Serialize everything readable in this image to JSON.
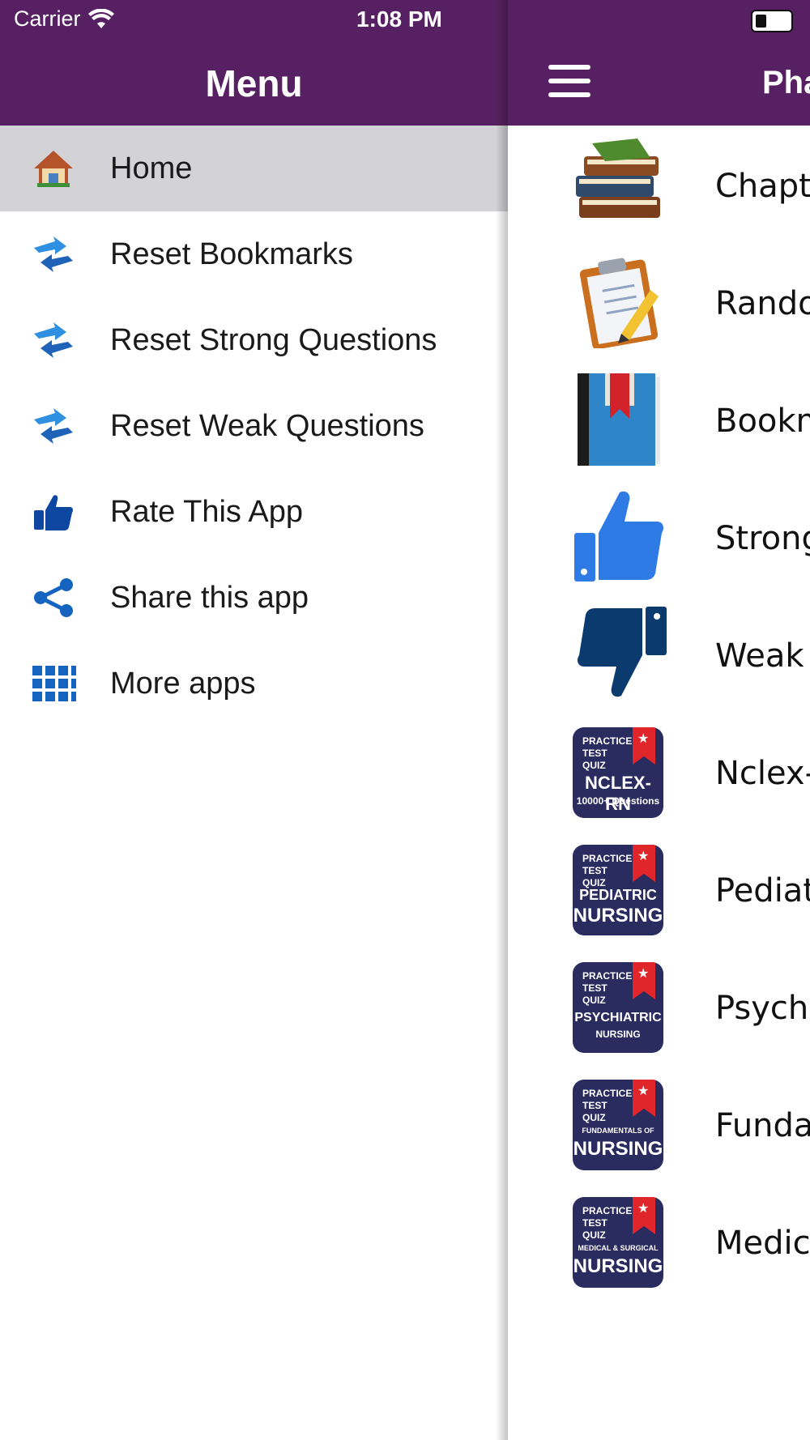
{
  "status_bar": {
    "carrier": "Carrier",
    "time": "1:08 PM"
  },
  "drawer": {
    "title": "Menu",
    "items": [
      {
        "label": "Home",
        "icon": "home-icon",
        "active": true
      },
      {
        "label": "Reset Bookmarks",
        "icon": "reset-icon"
      },
      {
        "label": "Reset Strong Questions",
        "icon": "reset-icon"
      },
      {
        "label": "Reset Weak Questions",
        "icon": "reset-icon"
      },
      {
        "label": "Rate This App",
        "icon": "thumbs-up-icon"
      },
      {
        "label": "Share this app",
        "icon": "share-icon"
      },
      {
        "label": "More apps",
        "icon": "grid-icon"
      }
    ]
  },
  "main": {
    "title": "Pha",
    "items": [
      {
        "label": "Chapte",
        "icon": "books-icon"
      },
      {
        "label": "Rando",
        "icon": "clipboard-icon"
      },
      {
        "label": "Bookm",
        "icon": "bookmark-book-icon"
      },
      {
        "label": "Strong",
        "icon": "thumbs-up-icon"
      },
      {
        "label": "Weak",
        "icon": "thumbs-down-icon"
      },
      {
        "label": "Nclex-",
        "icon": "nclex-app-icon",
        "badge_top": "PRACTICE TEST QUIZ",
        "badge_main": "NCLEX-RN",
        "badge_sub": "10000+ Questions"
      },
      {
        "label": "Pediat",
        "icon": "pediatric-app-icon",
        "badge_top": "PRACTICE TEST QUIZ",
        "badge_main": "PEDIATRIC",
        "badge_sub": "NURSING"
      },
      {
        "label": "Psychi",
        "icon": "psychiatric-app-icon",
        "badge_top": "PRACTICE TEST QUIZ",
        "badge_main": "PSYCHIATRIC",
        "badge_sub": "NURSING"
      },
      {
        "label": "Funda",
        "icon": "fundamentals-app-icon",
        "badge_top": "PRACTICE TEST QUIZ",
        "badge_main": "FUNDAMENTALS OF",
        "badge_sub": "NURSING"
      },
      {
        "label": "Medica",
        "icon": "medsurg-app-icon",
        "badge_top": "PRACTICE TEST QUIZ",
        "badge_main": "MEDICAL & SURGICAL",
        "badge_sub": "NURSING"
      }
    ]
  },
  "colors": {
    "header": "#572062",
    "active_row": "#d2d2d7",
    "icon_blue": "#1565c0",
    "badge_bg": "#2a2b5e",
    "ribbon_red": "#e0252b"
  }
}
